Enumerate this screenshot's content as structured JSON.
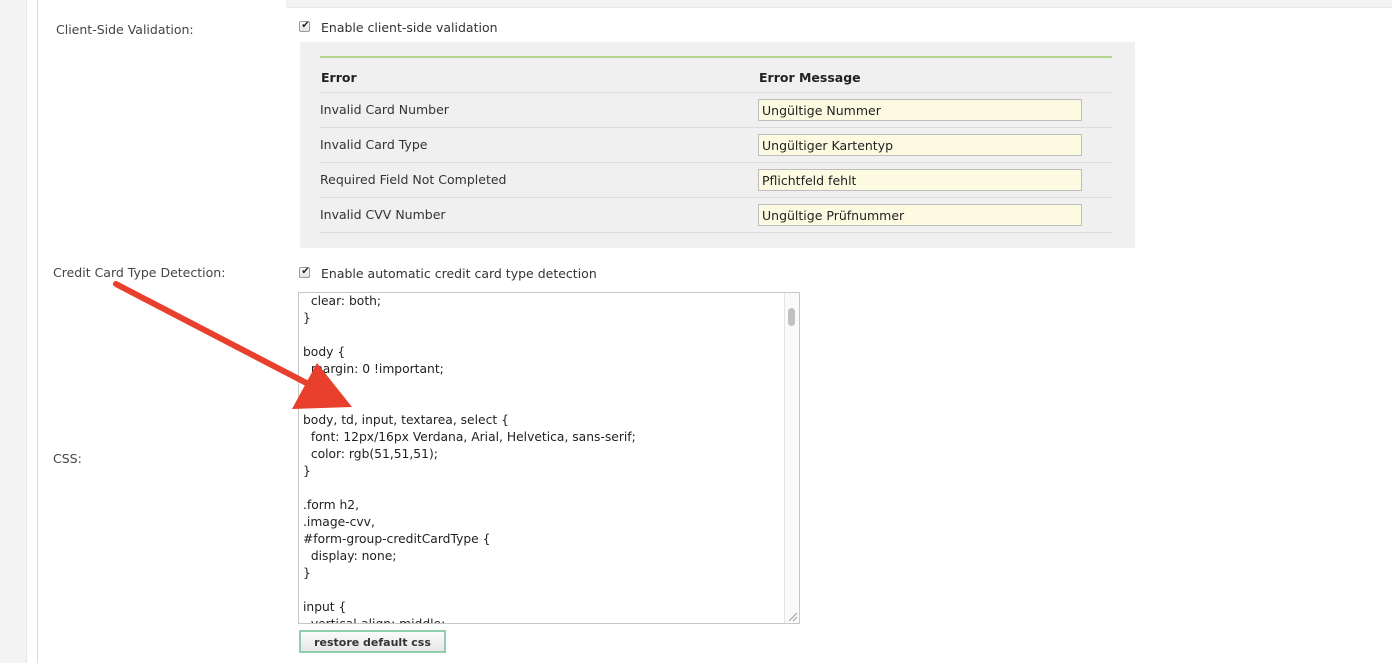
{
  "client_side": {
    "label": "Client-Side Validation:",
    "checkbox_label": "Enable client-side validation",
    "checked": true,
    "errors_table": {
      "header_error": "Error",
      "header_message": "Error Message",
      "rows": [
        {
          "error": "Invalid Card Number",
          "message": "Ungültige Nummer"
        },
        {
          "error": "Invalid Card Type",
          "message": "Ungültiger Kartentyp"
        },
        {
          "error": "Required Field Not Completed",
          "message": "Pflichtfeld fehlt"
        },
        {
          "error": "Invalid CVV Number",
          "message": "Ungültige Prüfnummer"
        }
      ]
    }
  },
  "card_detection": {
    "label": "Credit Card Type Detection:",
    "checkbox_label": "Enable automatic credit card type detection",
    "checked": true
  },
  "css": {
    "label": "CSS:",
    "content": "  clear: both;\n}\n\nbody {\n  margin: 0 !important;\n}\n\nbody, td, input, textarea, select {\n  font: 12px/16px Verdana, Arial, Helvetica, sans-serif;\n  color: rgb(51,51,51);\n}\n\n.form h2,\n.image-cvv,\n#form-group-creditCardType {\n  display: none;\n}\n\ninput {\n  vertical-align: middle;",
    "restore_button": "restore default css"
  },
  "annotation": {
    "arrow_color": "#e8402c"
  },
  "colors": {
    "accent_green": "#b6d38c",
    "input_bg": "#fcfbe2",
    "button_border": "#8fcfae"
  }
}
